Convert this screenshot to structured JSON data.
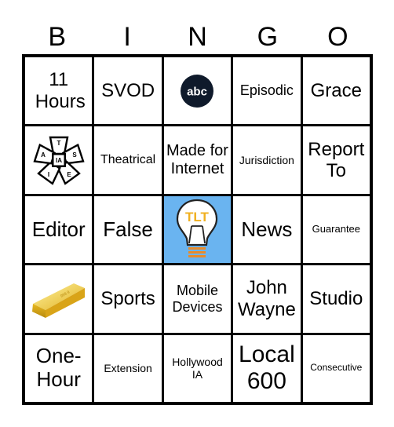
{
  "header": {
    "letters": [
      "B",
      "I",
      "N",
      "G",
      "O"
    ]
  },
  "cells": [
    {
      "label": "11 Hours"
    },
    {
      "label": "SVOD"
    },
    {
      "icon": "abc-logo",
      "label": "abc"
    },
    {
      "label": "Episodic"
    },
    {
      "label": "Grace"
    },
    {
      "icon": "iatse-logo",
      "label": "IA",
      "letters": [
        "T",
        "S",
        "E",
        "I",
        "A"
      ]
    },
    {
      "label": "Theatrical"
    },
    {
      "label": "Made for Internet"
    },
    {
      "label": "Jurisdiction"
    },
    {
      "label": "Report To"
    },
    {
      "label": "Editor"
    },
    {
      "label": "False"
    },
    {
      "icon": "tlt-lightbulb-logo",
      "label": "TLT",
      "free": true
    },
    {
      "label": "News"
    },
    {
      "label": "Guarantee"
    },
    {
      "icon": "gold-bar-image"
    },
    {
      "label": "Sports"
    },
    {
      "label": "Mobile Devices"
    },
    {
      "label": "John Wayne"
    },
    {
      "label": "Studio"
    },
    {
      "label": "One-Hour"
    },
    {
      "label": "Extension"
    },
    {
      "label": "Hollywood IA"
    },
    {
      "label": "Local 600"
    },
    {
      "label": "Consecutive"
    }
  ],
  "colors": {
    "free_space_bg": "#6ab4f0",
    "abc_bg": "#0f1a2b",
    "tlt_text": "#f0b020",
    "bulb_base": "#e88a2a",
    "gold": "#e8b820"
  }
}
